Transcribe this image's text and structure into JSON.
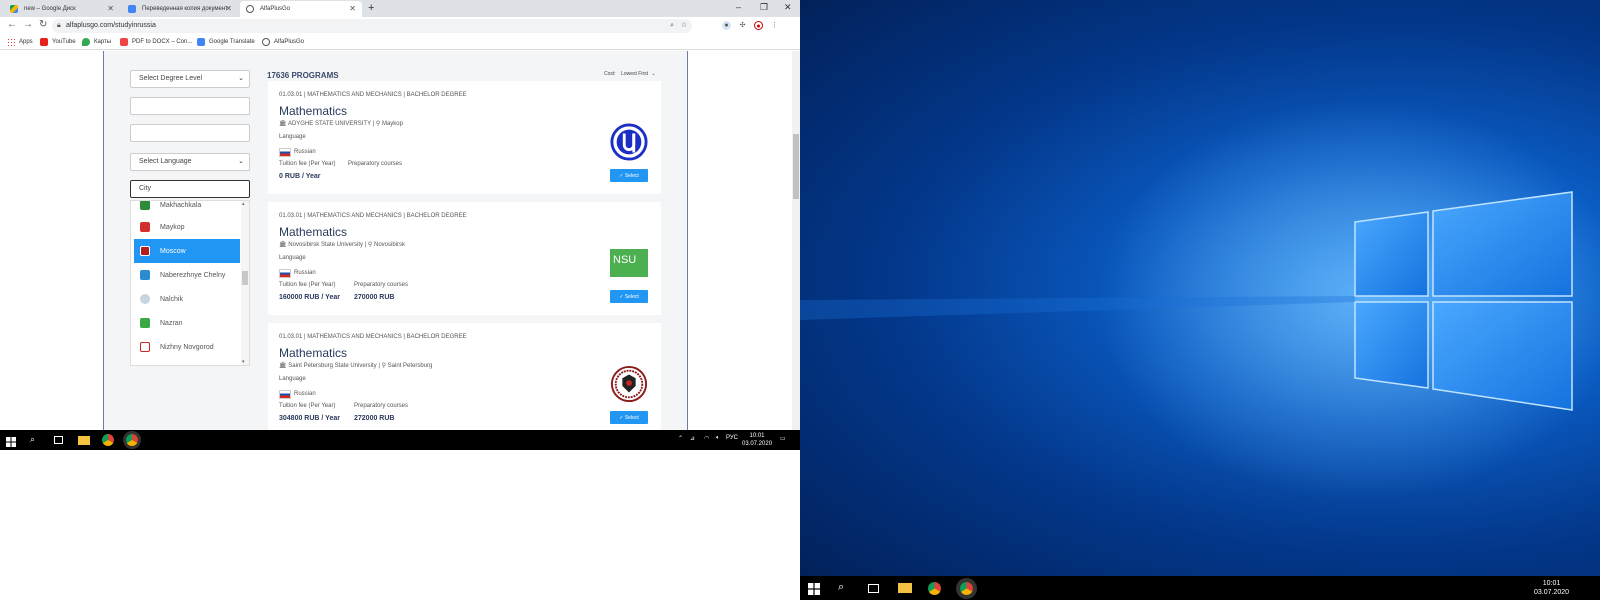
{
  "browser": {
    "tabs": [
      {
        "label": "new – Google Диск",
        "icon": "google-drive-icon"
      },
      {
        "label": "Переведенная копия документ",
        "icon": "google-docs-icon"
      },
      {
        "label": "AlfaPlusGo",
        "icon": "globe-icon"
      }
    ],
    "url": "alfaplusgo.com/studyinrussia",
    "bookmarks": [
      "Apps",
      "YouTube",
      "Карты",
      "PDF to DOCX – Con...",
      "Google Translate",
      "AlfaPlusGo"
    ]
  },
  "filters": {
    "degree_level": "Select Degree Level",
    "language": "Select Language",
    "city_placeholder": "City"
  },
  "city_list": [
    {
      "name": "Makhachkala",
      "selected": false
    },
    {
      "name": "Maykop",
      "selected": false
    },
    {
      "name": "Moscow",
      "selected": true
    },
    {
      "name": "Naberezhnye Chelny",
      "selected": false
    },
    {
      "name": "Nalchik",
      "selected": false
    },
    {
      "name": "Nazran",
      "selected": false
    },
    {
      "name": "Nizhny Novgorod",
      "selected": false
    }
  ],
  "results": {
    "count": "17636 PROGRAMS",
    "sort_label": "Cost:",
    "sort_value": "Lowest First"
  },
  "programs": [
    {
      "code": "01.03.01 | MATHEMATICS AND MECHANICS | BACHELOR DEGREE",
      "title": "Mathematics",
      "university": "ADYGHE STATE UNIVERSITY",
      "city": "Maykop",
      "language_label": "Language",
      "language": "Russian",
      "fee_label": "Tuition fee (Per Year)",
      "prep_label": "Preparatory courses",
      "fee": "0 RUB / Year",
      "prep": "",
      "select_label": "Select"
    },
    {
      "code": "01.03.01 | MATHEMATICS AND MECHANICS | BACHELOR DEGREE",
      "title": "Mathematics",
      "university": "Novosibirsk State University",
      "city": "Novosibirsk",
      "language_label": "Language",
      "language": "Russian",
      "fee_label": "Tuition fee (Per Year)",
      "prep_label": "Preparatory courses",
      "fee": "160000 RUB / Year",
      "prep": "270000 RUB",
      "logo_text": "NSU",
      "select_label": "Select"
    },
    {
      "code": "01.03.01 | MATHEMATICS AND MECHANICS | BACHELOR DEGREE",
      "title": "Mathematics",
      "university": "Saint Petersburg State University",
      "city": "Saint Petersburg",
      "language_label": "Language",
      "language": "Russian",
      "fee_label": "Tuition fee (Per Year)",
      "prep_label": "Preparatory courses",
      "fee": "304800 RUB / Year",
      "prep": "272000 RUB",
      "select_label": "Select"
    }
  ],
  "taskbar": {
    "lang": "РУС",
    "time": "10:01",
    "date": "03.07.2020"
  },
  "colors": {
    "accent": "#2196f3",
    "title": "#2a3a5c"
  }
}
